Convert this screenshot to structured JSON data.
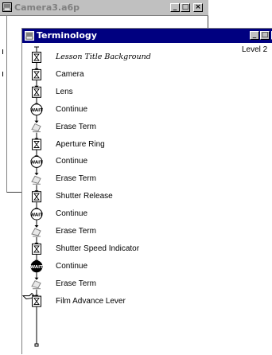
{
  "back_window": {
    "title": "Camera3.a6p",
    "minimize_icon": "minimize-icon",
    "maximize_icon": "maximize-icon",
    "close_icon": "close-icon"
  },
  "front_window": {
    "title": "Terminology",
    "level_label": "Level 2",
    "minimize_icon": "minimize-icon",
    "maximize_icon": "maximize-icon",
    "close_icon": "close-icon"
  },
  "flowline": {
    "icons": [
      {
        "label": "Lesson Title Background",
        "icon": "display-icon"
      },
      {
        "label": "Camera",
        "icon": "display-icon"
      },
      {
        "label": "Lens",
        "icon": "display-icon"
      },
      {
        "label": "Continue",
        "icon": "wait-icon"
      },
      {
        "label": "Erase Term",
        "icon": "erase-icon"
      },
      {
        "label": "Aperture Ring",
        "icon": "display-icon"
      },
      {
        "label": "Continue",
        "icon": "wait-icon"
      },
      {
        "label": "Erase Term",
        "icon": "erase-icon"
      },
      {
        "label": "Shutter Release",
        "icon": "display-icon"
      },
      {
        "label": "Continue",
        "icon": "wait-icon"
      },
      {
        "label": "Erase Term",
        "icon": "erase-icon"
      },
      {
        "label": "Shutter Speed Indicator",
        "icon": "display-icon"
      },
      {
        "label": "Continue",
        "icon": "wait-icon"
      },
      {
        "label": "Erase Term",
        "icon": "erase-icon"
      },
      {
        "label": "Film Advance Lever",
        "icon": "display-icon"
      }
    ],
    "selected_index": 12,
    "paste_hand_icon": "paste-hand-icon"
  },
  "colors": {
    "active_title": "#000080",
    "inactive_title": "#c0c0c0",
    "window_bg": "#ffffff"
  }
}
